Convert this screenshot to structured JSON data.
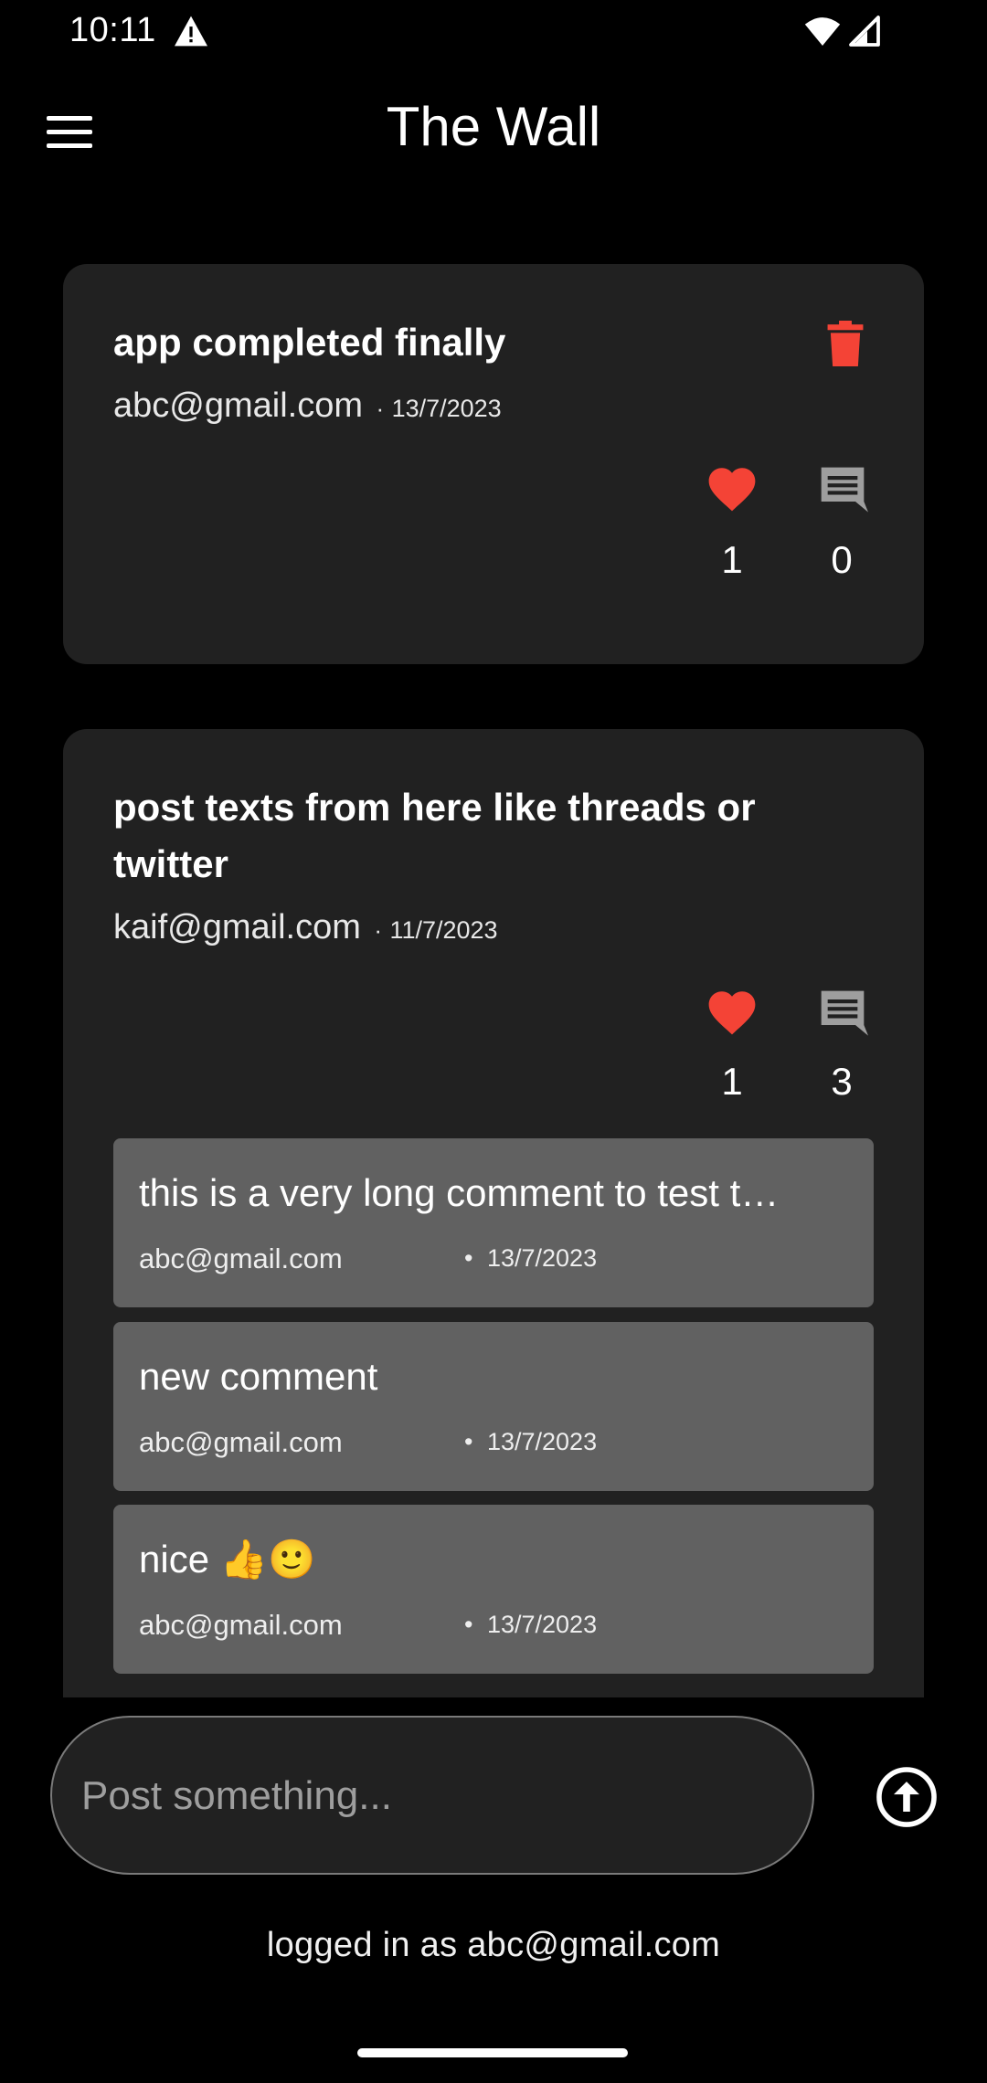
{
  "status_bar": {
    "time": "10:11",
    "icons": [
      "warning-icon",
      "wifi-icon",
      "cell-signal-icon"
    ]
  },
  "app_bar": {
    "title": "The Wall",
    "menu_icon": "menu-icon"
  },
  "posts": [
    {
      "title": "app completed finally",
      "user": "abc@gmail.com",
      "separator": "·",
      "date": "13/7/2023",
      "likes": "1",
      "comment_count": "0",
      "has_delete": true
    },
    {
      "title_line1": "post texts from here like threads or",
      "title_line2": "twitter",
      "user": "kaif@gmail.com",
      "separator": "·",
      "date": "11/7/2023",
      "likes": "1",
      "comment_count": "3",
      "comments": [
        {
          "text": "this is a very long comment to test t…",
          "user": "abc@gmail.com",
          "separator": "•",
          "date": "13/7/2023"
        },
        {
          "text": "new comment",
          "user": "abc@gmail.com",
          "separator": "•",
          "date": "13/7/2023"
        },
        {
          "text": "nice 👍🙂",
          "user": "abc@gmail.com",
          "separator": "•",
          "date": "13/7/2023"
        }
      ]
    }
  ],
  "composer": {
    "placeholder": "Post something...",
    "value": ""
  },
  "footer": {
    "logged_in_text": "logged in as abc@gmail.com"
  },
  "colors": {
    "background": "#000000",
    "card": "#212121",
    "comment": "#616161",
    "heart": "#f44336",
    "delete": "#f44336",
    "comment_icon": "#9e9e9e"
  }
}
